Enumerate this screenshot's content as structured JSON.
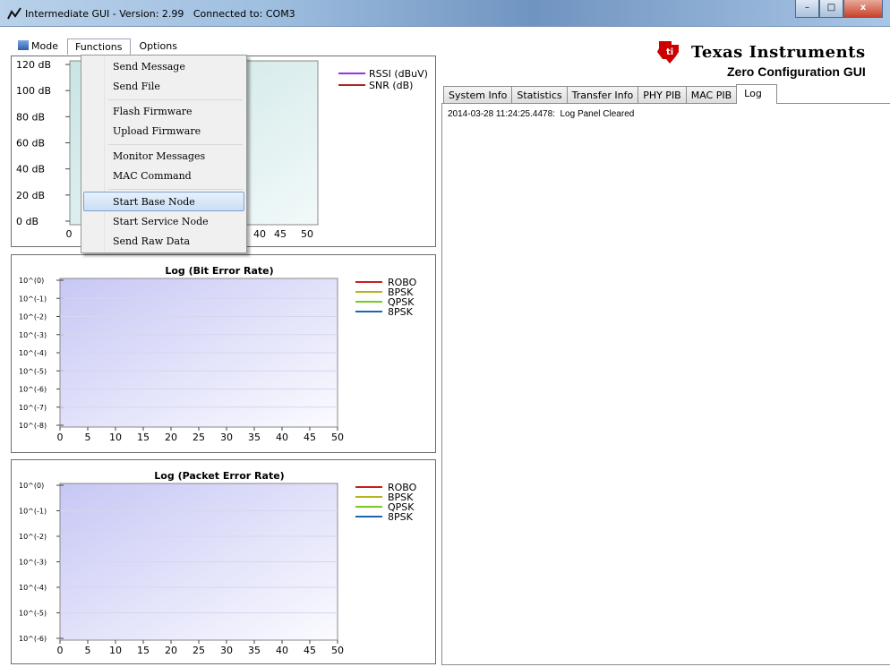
{
  "window": {
    "title": "Intermediate GUI - Version: 2.99   Connected to: COM3",
    "buttons": {
      "minimize": "–",
      "maximize": "□",
      "close": "x"
    }
  },
  "menubar": {
    "items": [
      {
        "label": "Mode",
        "icon": "mode-icon"
      },
      {
        "label": "Functions"
      },
      {
        "label": "Options"
      }
    ]
  },
  "functions_menu": {
    "items": [
      "Send Message",
      "Send File",
      "Flash Firmware",
      "Upload Firmware",
      "Monitor Messages",
      "MAC Command",
      "Start Base Node",
      "Start Service Node",
      "Send Raw Data"
    ],
    "highlighted": "Start Base Node"
  },
  "header": {
    "brand": "Texas Instruments",
    "subtitle": "Zero Configuration GUI"
  },
  "tabs": [
    {
      "label": "System Info"
    },
    {
      "label": "Statistics"
    },
    {
      "label": "Transfer Info"
    },
    {
      "label": "PHY PIB"
    },
    {
      "label": "MAC PIB"
    },
    {
      "label": "Log",
      "active": true
    }
  ],
  "log": {
    "entries": [
      {
        "timestamp": "2014-03-28 11:24:25.4478:",
        "message": "Log Panel Cleared"
      }
    ]
  },
  "colors": {
    "rssi": "#9b30e6",
    "snr": "#b42424",
    "robo": "#c81e1e",
    "bpsk": "#b4b41e",
    "qpsk": "#78c81e",
    "8psk": "#1e64b4"
  },
  "chart_data": [
    {
      "type": "line",
      "title": "",
      "y_ticks": [
        "120 dB",
        "100 dB",
        "80 dB",
        "60 dB",
        "40 dB",
        "20 dB",
        "0 dB"
      ],
      "x_ticks": [
        "0",
        "40",
        "45",
        "50"
      ],
      "xlim": [
        0,
        50
      ],
      "ylim": [
        0,
        120
      ],
      "series": [
        {
          "name": "RSSI (dBuV)",
          "values": []
        },
        {
          "name": "SNR (dB)",
          "values": []
        }
      ],
      "legend": "top-right"
    },
    {
      "type": "line",
      "title": "Log (Bit Error Rate)",
      "y_ticks": [
        "10^(0)",
        "10^(-1)",
        "10^(-2)",
        "10^(-3)",
        "10^(-4)",
        "10^(-5)",
        "10^(-6)",
        "10^(-7)",
        "10^(-8)"
      ],
      "x_ticks": [
        "0",
        "5",
        "10",
        "15",
        "20",
        "25",
        "30",
        "35",
        "40",
        "45",
        "50"
      ],
      "xlim": [
        0,
        50
      ],
      "series": [
        {
          "name": "ROBO",
          "values": []
        },
        {
          "name": "BPSK",
          "values": []
        },
        {
          "name": "QPSK",
          "values": []
        },
        {
          "name": "8PSK",
          "values": []
        }
      ],
      "legend": "top-right"
    },
    {
      "type": "line",
      "title": "Log (Packet Error Rate)",
      "y_ticks": [
        "10^(0)",
        "10^(-1)",
        "10^(-2)",
        "10^(-3)",
        "10^(-4)",
        "10^(-5)",
        "10^(-6)"
      ],
      "x_ticks": [
        "0",
        "5",
        "10",
        "15",
        "20",
        "25",
        "30",
        "35",
        "40",
        "45",
        "50"
      ],
      "xlim": [
        0,
        50
      ],
      "series": [
        {
          "name": "ROBO",
          "values": []
        },
        {
          "name": "BPSK",
          "values": []
        },
        {
          "name": "QPSK",
          "values": []
        },
        {
          "name": "8PSK",
          "values": []
        }
      ],
      "legend": "top-right"
    }
  ]
}
